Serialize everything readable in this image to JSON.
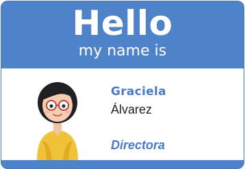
{
  "header": {
    "title": "Hello",
    "subtitle": "my name is"
  },
  "person": {
    "first_name": "Graciela",
    "last_name": "Álvarez",
    "role": "Directora"
  },
  "avatar": {
    "icon": "woman-avatar-icon"
  },
  "colors": {
    "badge_blue": "#4f83c9",
    "accent_blue": "#4a7ac4",
    "shirt_yellow": "#f0c23a",
    "hair": "#1f1f24"
  }
}
